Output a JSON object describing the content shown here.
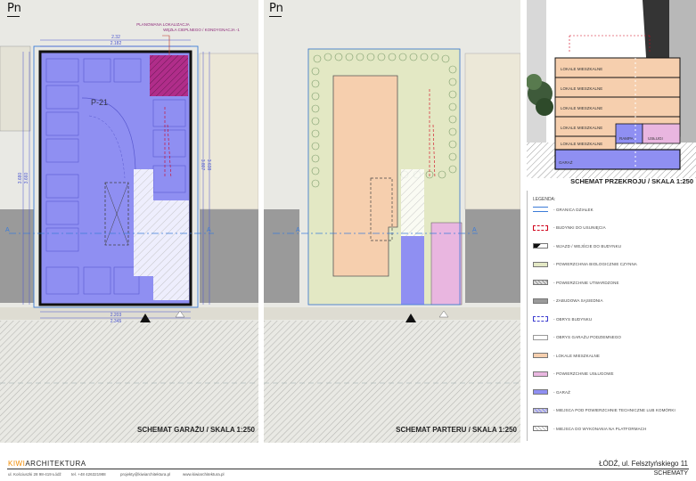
{
  "north_label": "Pn",
  "garage_panel": {
    "caption": "SCHEMAT GARAŻU / SKALA 1:250",
    "plot_label": "P-21",
    "callout_line1": "PLANOWANA LOKALIZACJA",
    "callout_line2": "WĘZŁA CIEPLNEGO / KONDYGNACJA -1",
    "dim_top1": "2.32",
    "dim_top2": "2.182",
    "dim_bottom1": "2.203",
    "dim_bottom2": "2.345",
    "dim_left1": "3.680",
    "dim_left2": "3.660",
    "dim_right1": "3.807",
    "dim_right2": "3.638",
    "section_mark": "A"
  },
  "ground_panel": {
    "caption": "SCHEMAT PARTERU / SKALA 1:250",
    "section_mark": "A"
  },
  "section_panel": {
    "caption": "SCHEMAT PRZEKROJU / SKALA 1:250",
    "floor_labels": [
      "LOKALE MIESZKALNE",
      "LOKALE MIESZKALNE",
      "LOKALE MIESZKALNE",
      "LOKALE MIESZKALNE",
      "LOKALE MIESZKALNE"
    ],
    "ramp_label": "RAMPA",
    "service_label": "USŁUGI",
    "garage_label": "GARAŻ"
  },
  "legend": {
    "title": "LEGENDA:",
    "items": [
      {
        "label": "- GRANICA DZIAŁEK",
        "swatch": "line-blue"
      },
      {
        "label": "- BUDYNKI DO USUNIĘCIA",
        "swatch": "dash-red"
      },
      {
        "label": "- WJAZD / WEJŚCIE DO BUDYNKU",
        "swatch": "triangles"
      },
      {
        "label": "- POWIERZCHNIA BIOLOGICZNIE CZYNNA",
        "swatch": "#e3e8c4"
      },
      {
        "label": "- POWIERZCHNIE UTWARDZONE",
        "swatch": "hatch-grey"
      },
      {
        "label": "- ZABUDOWA SĄSIEDNIA",
        "swatch": "#9a9a9a"
      },
      {
        "label": "- OBRYS BUDYNKU",
        "swatch": "dash-blue"
      },
      {
        "label": "- OBRYS GARAŻU PODZIEMNEGO",
        "swatch": "outline-grey"
      },
      {
        "label": "- LOKALE MIESZKALNE",
        "swatch": "#f6cfae"
      },
      {
        "label": "- POWIERZCHNIE USŁUGOWE",
        "swatch": "#e9b6e0"
      },
      {
        "label": "- GARAŻ",
        "swatch": "#8f8ff2"
      },
      {
        "label": "- MIEJSCA POD POWIERZCHNIE TECHNICZNE LUB KOMÓRKI",
        "swatch": "hatch-blue"
      },
      {
        "label": "- MIEJSCA DO WYKONANIA NA PLATFORMACH",
        "swatch": "hatch-white"
      }
    ]
  },
  "footer": {
    "brand_accent": "KIWI",
    "brand_rest": "ARCHITEKTURA",
    "address_line": "ul. Kościuszki 28 98-419 Łódź",
    "phone": "tel. +48 426321988",
    "email": "projekty@kiwiarchitektura.pl",
    "website": "www.kiwiarchitektura.pl",
    "project_address": "ŁÓDŹ, ul. Felsztyńskiego 11",
    "sheet_title": "SCHEMATY"
  },
  "colors": {
    "garage": "#8f8ff2",
    "residential": "#f6cfae",
    "service": "#e9b6e0",
    "green": "#e3e8c4",
    "accent": "#f08a00"
  }
}
